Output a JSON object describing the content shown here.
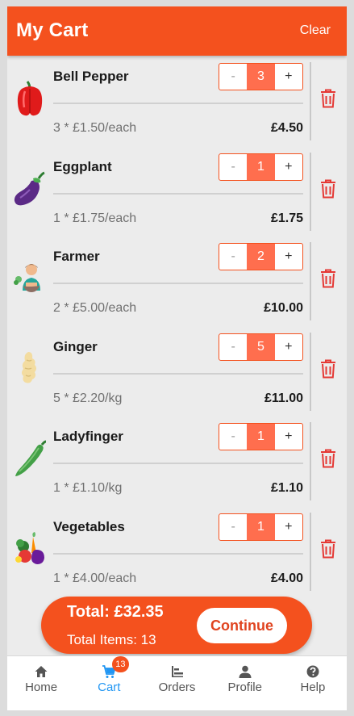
{
  "header": {
    "title": "My Cart",
    "clear_label": "Clear"
  },
  "stepper": {
    "minus": "-",
    "plus": "+"
  },
  "cart_items": [
    {
      "name": "Bell Pepper",
      "qty": "3",
      "price_each": "3 * £1.50/each",
      "total": "£4.50",
      "image_icon": "bell-pepper-image"
    },
    {
      "name": "Eggplant",
      "qty": "1",
      "price_each": "1 * £1.75/each",
      "total": "£1.75",
      "image_icon": "eggplant-image"
    },
    {
      "name": "Farmer",
      "qty": "2",
      "price_each": "2 * £5.00/each",
      "total": "£10.00",
      "image_icon": "farmer-image"
    },
    {
      "name": "Ginger",
      "qty": "5",
      "price_each": "5 * £2.20/kg",
      "total": "£11.00",
      "image_icon": "ginger-image"
    },
    {
      "name": "Ladyfinger",
      "qty": "1",
      "price_each": "1 * £1.10/kg",
      "total": "£1.10",
      "image_icon": "ladyfinger-image"
    },
    {
      "name": "Vegetables",
      "qty": "1",
      "price_each": "1 * £4.00/each",
      "total": "£4.00",
      "image_icon": "vegetables-image"
    }
  ],
  "checkout": {
    "total": "Total: £32.35",
    "items": "Total Items: 13",
    "continue_label": "Continue"
  },
  "tabs": [
    {
      "label": "Home",
      "icon": "home-icon"
    },
    {
      "label": "Cart",
      "icon": "cart-icon",
      "badge": "13"
    },
    {
      "label": "Orders",
      "icon": "orders-icon"
    },
    {
      "label": "Profile",
      "icon": "profile-icon"
    },
    {
      "label": "Help",
      "icon": "help-icon"
    }
  ],
  "colors": {
    "primary": "#f4511e",
    "qty_bg": "#ff6e4e",
    "active_tab": "#2196f3",
    "trash": "#e53935"
  }
}
